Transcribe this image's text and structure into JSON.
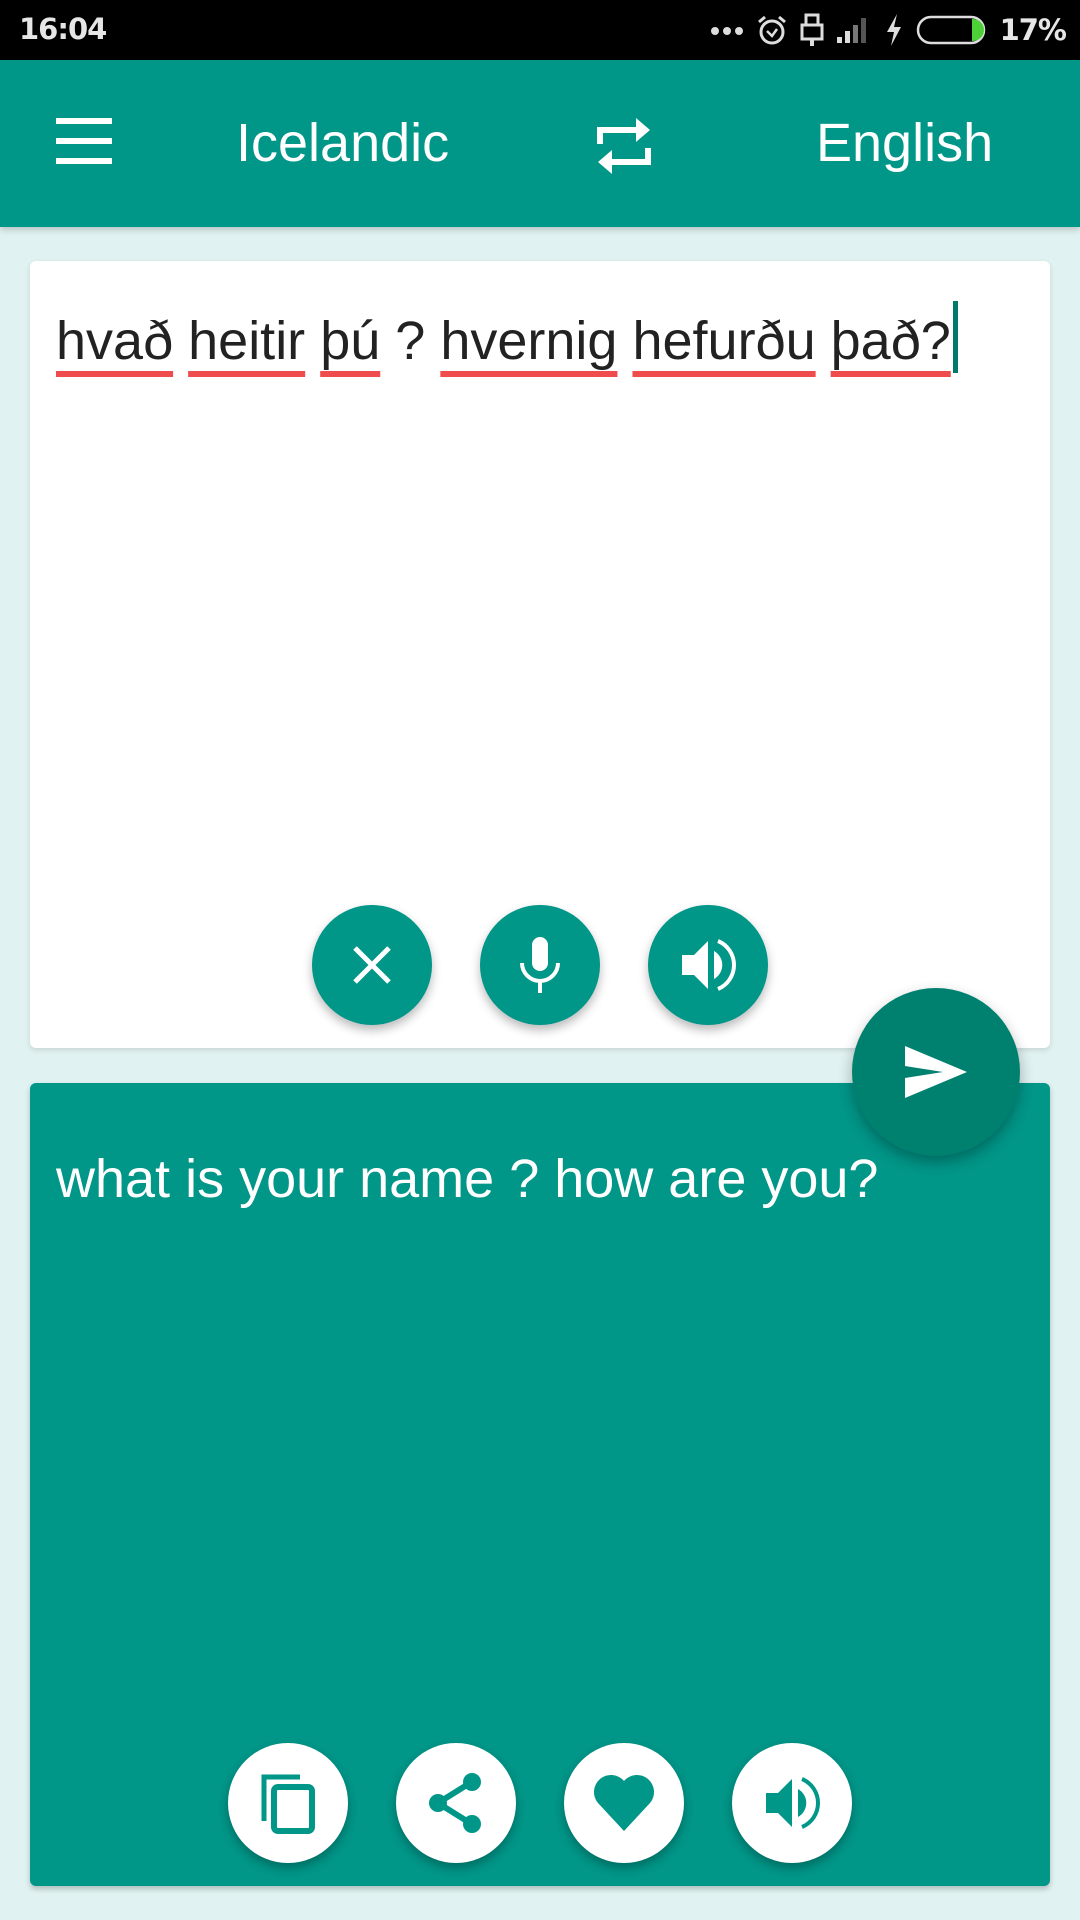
{
  "status_bar": {
    "time": "16:04",
    "battery_percent": "17%",
    "battery_level": 0.17,
    "icons": [
      "more-dots-icon",
      "alarm-icon",
      "usb-icon",
      "signal-icon",
      "charging-icon",
      "battery-icon"
    ]
  },
  "app_bar": {
    "menu_icon": "hamburger-menu-icon",
    "source_language": "Icelandic",
    "swap_icon": "swap-languages-icon",
    "target_language": "English"
  },
  "input_card": {
    "words": [
      "hvað",
      "heitir",
      "þú",
      "?",
      "hvernig",
      "hefurðu",
      "það?"
    ],
    "misspelled": [
      true,
      true,
      true,
      false,
      true,
      true,
      true
    ],
    "text": "hvað heitir þú ? hvernig hefurðu það?",
    "buttons": [
      {
        "name": "clear",
        "icon": "close-icon"
      },
      {
        "name": "voice-input",
        "icon": "microphone-icon"
      },
      {
        "name": "speak-source",
        "icon": "speaker-icon"
      }
    ]
  },
  "translate_button": {
    "icon": "send-icon"
  },
  "output_card": {
    "text": "what is your name ? how are you?",
    "buttons": [
      {
        "name": "copy",
        "icon": "copy-icon"
      },
      {
        "name": "share",
        "icon": "share-icon"
      },
      {
        "name": "favorite",
        "icon": "heart-icon"
      },
      {
        "name": "speak-translation",
        "icon": "speaker-icon"
      }
    ]
  },
  "colors": {
    "primary": "#009688",
    "primary_dark": "#00806f",
    "background": "#e0f2f1",
    "spell_error": "#ef4d4d",
    "battery_fill": "#4cd137"
  }
}
